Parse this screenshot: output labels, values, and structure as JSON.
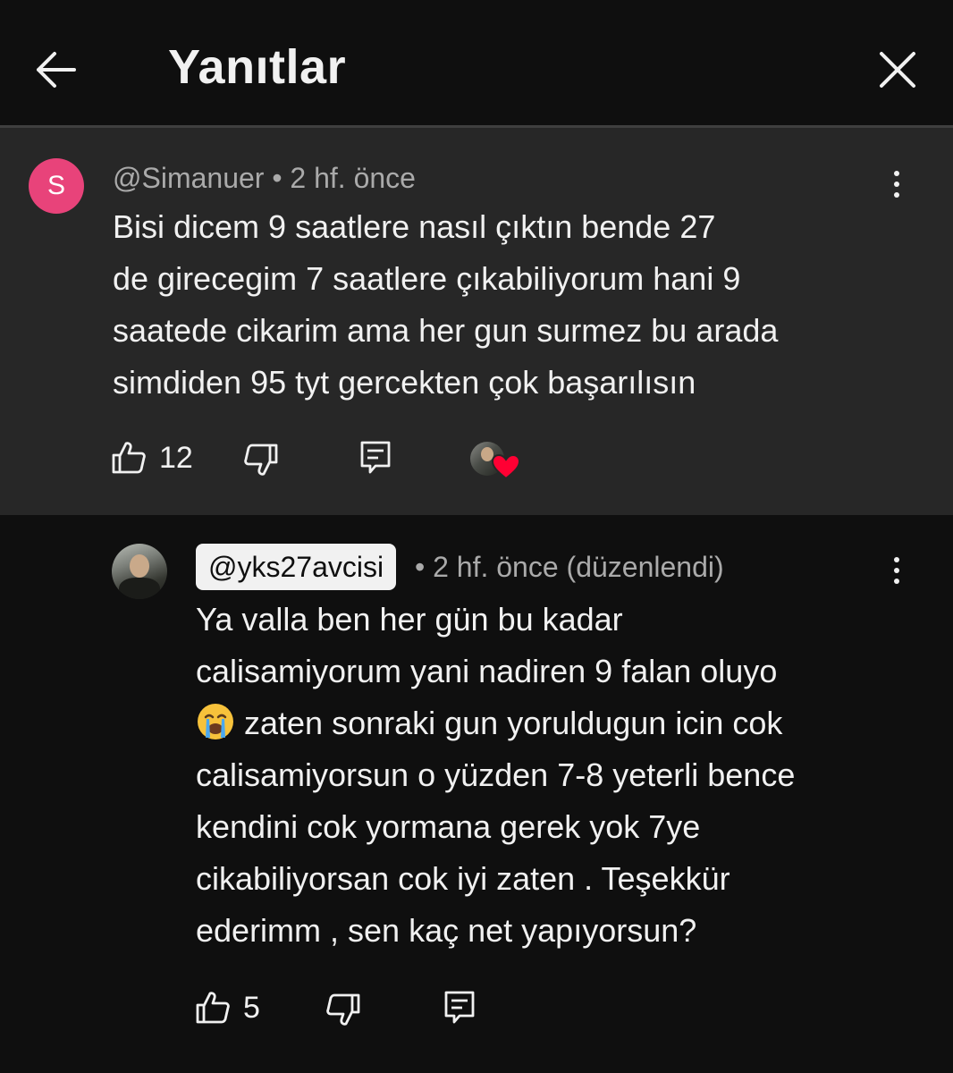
{
  "header": {
    "title": "Yanıtlar"
  },
  "parent_comment": {
    "avatar_letter": "S",
    "meta": "@Simanuer • 2 hf. önce",
    "text": "Bisi dicem 9 saatlere nasıl çıktın bende 27\nde girecegim 7 saatlere çıkabiliyorum hani 9\nsaatede cikarim ama her gun surmez bu arada\nsimdiden 95 tyt gercekten çok başarılısın",
    "likes": "12"
  },
  "reply_comment": {
    "author": "@yks27avcisi",
    "meta": "• 2 hf. önce (düzenlendi)",
    "text_line1": "Ya valla ben her gün bu kadar",
    "text_line2": "calisamiyorum yani nadiren 9 falan oluyo",
    "text_line3_after_emoji": " zaten sonraki gun yoruldugun icin cok",
    "text_rest": "calisamiyorsun o yüzden 7-8 yeterli bence\nkendini cok yormana gerek yok 7ye\ncikabiliyorsan cok iyi zaten . Teşekkür\nederimm , sen kaç net yapıyorsun?",
    "emoji": "crying-face-emoji",
    "likes": "5"
  },
  "colors": {
    "background": "#0f0f0f",
    "parent_background": "#272727",
    "avatar_s": "#e8437a",
    "heart": "#ff0033"
  }
}
